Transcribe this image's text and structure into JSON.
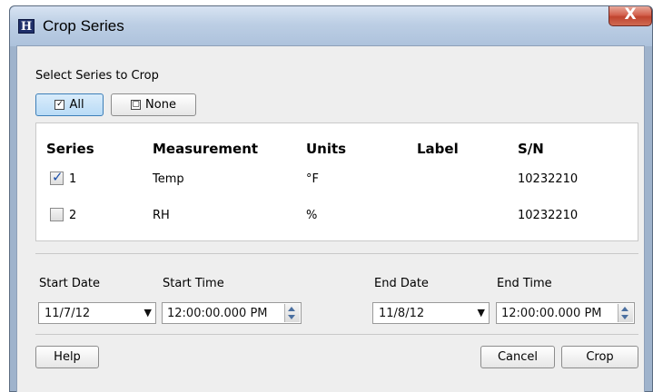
{
  "window": {
    "title": "Crop Series",
    "close_label": "X"
  },
  "select_section": {
    "label": "Select Series to Crop",
    "all_label": "All",
    "none_label": "None"
  },
  "table": {
    "headers": [
      "Series",
      "Measurement",
      "Units",
      "Label",
      "S/N"
    ],
    "rows": [
      {
        "series": "1",
        "checked": true,
        "measurement": "Temp",
        "units": "°F",
        "label": "",
        "sn": "10232210"
      },
      {
        "series": "2",
        "checked": false,
        "measurement": "RH",
        "units": "%",
        "label": "",
        "sn": "10232210"
      }
    ]
  },
  "range": {
    "start_date_label": "Start Date",
    "start_time_label": "Start Time",
    "end_date_label": "End Date",
    "end_time_label": "End Time",
    "start_date": "11/7/12",
    "start_time": "12:00:00.000 PM",
    "end_date": "11/8/12",
    "end_time": "12:00:00.000 PM"
  },
  "footer": {
    "help_label": "Help",
    "cancel_label": "Cancel",
    "crop_label": "Crop"
  }
}
